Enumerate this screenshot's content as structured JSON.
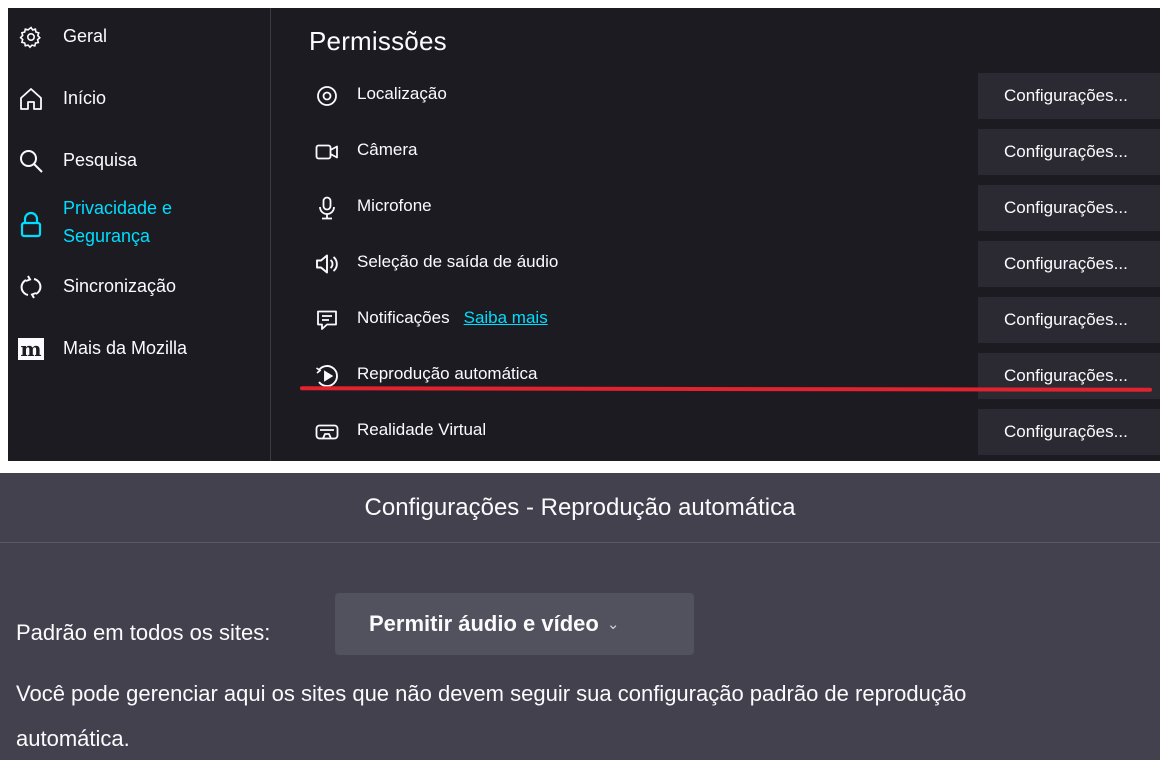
{
  "sidebar": {
    "items": [
      {
        "label": "Geral",
        "icon": "gear-icon"
      },
      {
        "label": "Início",
        "icon": "home-icon"
      },
      {
        "label": "Pesquisa",
        "icon": "search-icon"
      },
      {
        "label_line1": "Privacidade e",
        "label_line2": "Segurança",
        "icon": "lock-icon",
        "active": true
      },
      {
        "label": "Sincronização",
        "icon": "sync-icon"
      },
      {
        "label": "Mais da Mozilla",
        "icon": "mozilla-m-icon"
      }
    ]
  },
  "permissions": {
    "heading": "Permissões",
    "rows": [
      {
        "label": "Localização",
        "icon": "location-icon",
        "button": "Configurações..."
      },
      {
        "label": "Câmera",
        "icon": "camera-icon",
        "button": "Configurações..."
      },
      {
        "label": "Microfone",
        "icon": "microphone-icon",
        "button": "Configurações..."
      },
      {
        "label": "Seleção de saída de áudio",
        "icon": "speaker-icon",
        "button": "Configurações..."
      },
      {
        "label": "Notificações",
        "icon": "notification-icon",
        "link": "Saiba mais",
        "button": "Configurações..."
      },
      {
        "label": "Reprodução automática",
        "icon": "autoplay-icon",
        "button": "Configurações..."
      },
      {
        "label": "Realidade Virtual",
        "icon": "vr-headset-icon",
        "button": "Configurações..."
      }
    ]
  },
  "dialog": {
    "title": "Configurações - Reprodução automática",
    "default_label": "Padrão em todos os sites:",
    "default_value": "Permitir áudio e vídeo",
    "description_line1": "Você pode gerenciar aqui os sites que não devem seguir sua configuração padrão de reprodução",
    "description_line2": "automática."
  },
  "colors": {
    "panel_bg": "#1c1b22",
    "button_bg": "#2b2a33",
    "accent": "#00ddff",
    "highlight_line": "#e0232e",
    "dialog_bg": "#42414d"
  }
}
